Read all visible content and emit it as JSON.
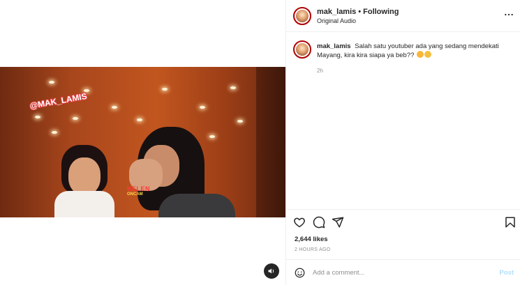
{
  "header": {
    "username": "mak_lamis",
    "separator": "•",
    "follow_label": "Following",
    "audio_label": "Original Audio"
  },
  "caption": {
    "username": "mak_lamis",
    "text": "Salah satu youtuber ada yang sedang mendekati Mayang, kira kira siapa ya beb??",
    "time": "2h"
  },
  "video": {
    "watermark_handle": "@MAK_LAMIS",
    "logo_top": "KELEN",
    "logo_bottom": "ONCAM"
  },
  "stats": {
    "likes": "2,644 likes",
    "posted_ago": "2 HOURS AGO"
  },
  "comment": {
    "placeholder": "Add a comment...",
    "post_label": "Post"
  },
  "icons": {
    "more": "more-options-icon",
    "like": "heart-icon",
    "comment": "comment-icon",
    "share": "share-icon",
    "save": "bookmark-icon",
    "emoji": "emoji-icon",
    "sound": "sound-icon"
  },
  "colors": {
    "post_disabled": "#b2dffc",
    "secondary_text": "#8e8e8e",
    "primary_text": "#262626",
    "divider": "#efefef"
  }
}
